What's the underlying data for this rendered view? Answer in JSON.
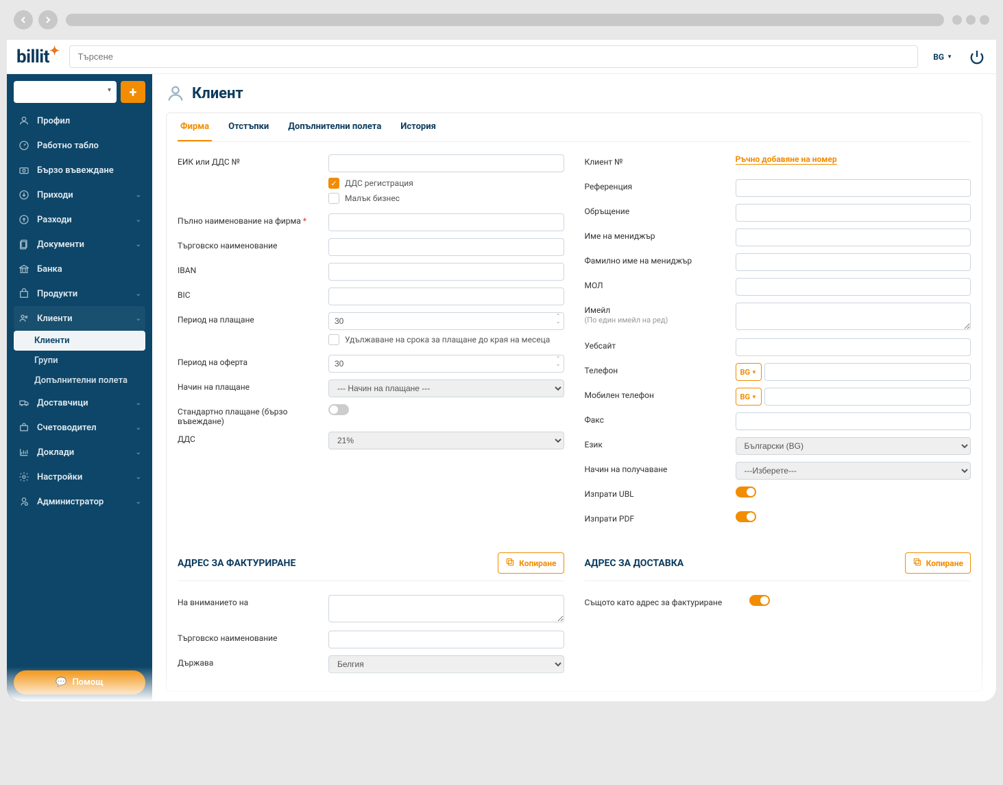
{
  "topbar": {
    "search_placeholder": "Търсене",
    "lang": "BG"
  },
  "sidebar": {
    "items": [
      {
        "label": "Профил",
        "icon": "user"
      },
      {
        "label": "Работно табло",
        "icon": "gauge"
      },
      {
        "label": "Бързо въвеждане",
        "icon": "camera"
      },
      {
        "label": "Приходи",
        "icon": "download",
        "expandable": true
      },
      {
        "label": "Разходи",
        "icon": "upload",
        "expandable": true
      },
      {
        "label": "Документи",
        "icon": "docs",
        "expandable": true
      },
      {
        "label": "Банка",
        "icon": "bank"
      },
      {
        "label": "Продукти",
        "icon": "box",
        "expandable": true
      },
      {
        "label": "Клиенти",
        "icon": "users",
        "expandable": true,
        "active": true
      },
      {
        "label": "Доставчици",
        "icon": "truck",
        "expandable": true
      },
      {
        "label": "Счетоводител",
        "icon": "briefcase",
        "expandable": true
      },
      {
        "label": "Доклади",
        "icon": "chart",
        "expandable": true
      },
      {
        "label": "Настройки",
        "icon": "gear",
        "expandable": true
      },
      {
        "label": "Администратор",
        "icon": "admin",
        "expandable": true
      }
    ],
    "sub_items": [
      "Клиенти",
      "Групи",
      "Допълнителни полета"
    ],
    "help": "Помощ",
    "add_plus": "+"
  },
  "page": {
    "title": "Клиент"
  },
  "tabs": [
    "Фирма",
    "Отстъпки",
    "Допълнителни полета",
    "История"
  ],
  "form_left": {
    "eik_label": "ЕИК или ДДС №",
    "dds_reg": "ДДС регистрация",
    "small_biz": "Малък бизнес",
    "full_name": "Пълно наименование на фирма",
    "trade_name": "Търговско наименование",
    "iban": "IBAN",
    "bic": "BIC",
    "pay_period": "Период на плащане",
    "pay_period_val": "30",
    "extend_eom": "Удължаване на срока за плащане до края на месеца",
    "offer_period": "Период на оферта",
    "offer_period_val": "30",
    "pay_method": "Начин на плащане",
    "pay_method_val": "--- Начин на плащане ---",
    "std_pay": "Стандартно плащане (бързо въвеждане)",
    "vat": "ДДС",
    "vat_val": "21%"
  },
  "form_right": {
    "client_no": "Клиент №",
    "manual_link": "Ръчно добавяне на номер",
    "reference": "Референция",
    "salutation": "Обръщение",
    "manager_first": "Име на мениджър",
    "manager_last": "Фамилно име на мениджър",
    "mol": "МОЛ",
    "email": "Имейл",
    "email_hint": "(По един имейл на ред)",
    "website": "Уебсайт",
    "phone": "Телефон",
    "mobile": "Мобилен телефон",
    "phone_prefix": "BG",
    "fax": "Факс",
    "language": "Език",
    "language_val": "Български (BG)",
    "receive_method": "Начин на получаване",
    "receive_method_val": "---Изберете---",
    "send_ubl": "Изпрати UBL",
    "send_pdf": "Изпрати PDF"
  },
  "billing": {
    "title": "АДРЕС ЗА ФАКТУРИРАНЕ",
    "copy_btn": "Копиране",
    "attention": "На вниманието на",
    "trade_name": "Търговско наименование",
    "country": "Държава",
    "country_val": "Белгия"
  },
  "delivery": {
    "title": "АДРЕС ЗА ДОСТАВКА",
    "copy_btn": "Копиране",
    "same_as_billing": "Същото като адрес за фактуриране"
  }
}
